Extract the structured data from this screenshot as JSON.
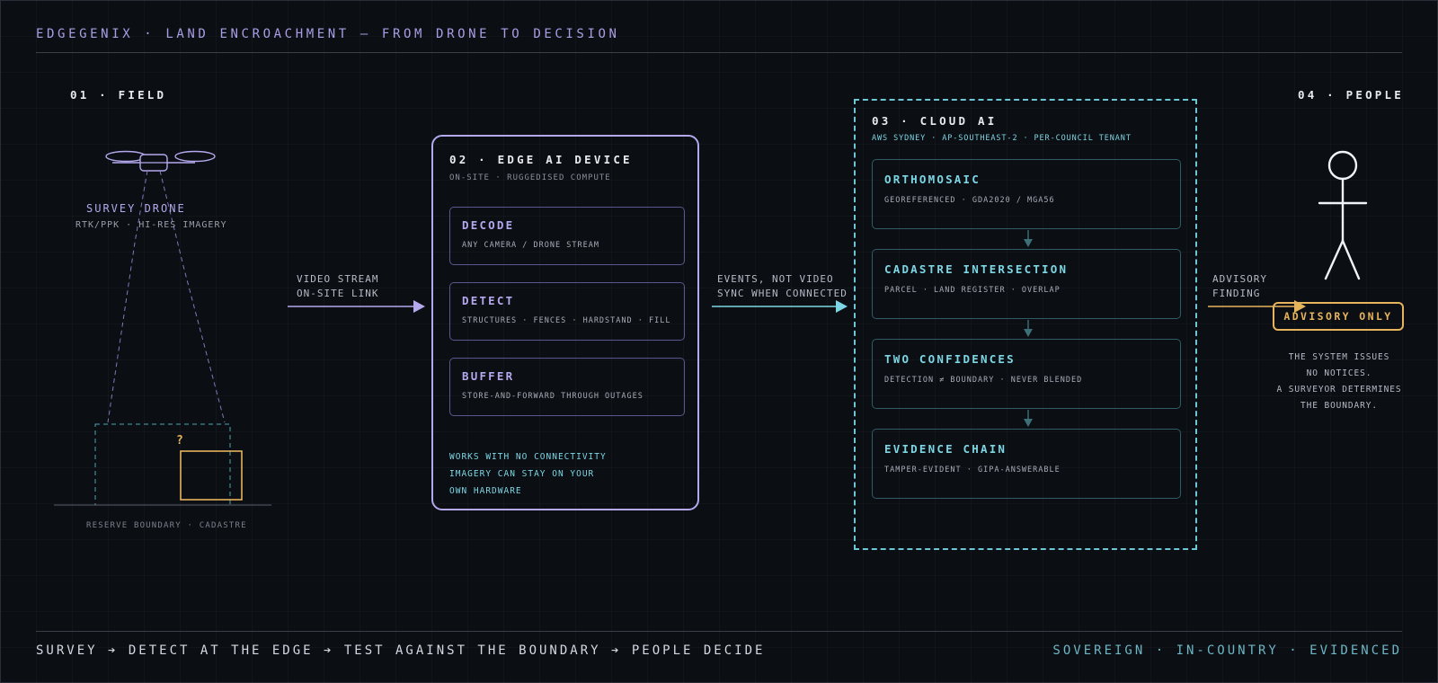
{
  "header": {
    "title": "EDGEGENIX · LAND ENCROACHMENT — FROM DRONE TO DECISION"
  },
  "field": {
    "title": "01 · FIELD",
    "drone_label": "SURVEY DRONE",
    "drone_sub": "RTK/PPK · HI-RES IMAGERY",
    "question_mark": "?",
    "ground_label": "RESERVE BOUNDARY · CADASTRE"
  },
  "link1": {
    "line1": "VIDEO STREAM",
    "line2": "ON-SITE LINK"
  },
  "edge": {
    "title": "02 · EDGE AI DEVICE",
    "subtitle": "ON-SITE · RUGGEDISED COMPUTE",
    "cards": [
      {
        "title": "DECODE",
        "sub": "ANY CAMERA / DRONE STREAM"
      },
      {
        "title": "DETECT",
        "sub": "STRUCTURES · FENCES · HARDSTAND · FILL"
      },
      {
        "title": "BUFFER",
        "sub": "STORE-AND-FORWARD THROUGH OUTAGES"
      }
    ],
    "notes": [
      "WORKS WITH NO CONNECTIVITY",
      "IMAGERY CAN STAY ON YOUR",
      "OWN HARDWARE"
    ]
  },
  "link2": {
    "line1": "EVENTS, NOT VIDEO",
    "line2": "SYNC WHEN CONNECTED"
  },
  "cloud": {
    "title": "03 · CLOUD AI",
    "subtitle": "AWS SYDNEY · AP-SOUTHEAST-2 · PER-COUNCIL TENANT",
    "cards": [
      {
        "title": "ORTHOMOSAIC",
        "sub": "GEOREFERENCED · GDA2020 / MGA56"
      },
      {
        "title": "CADASTRE INTERSECTION",
        "sub": "PARCEL · LAND REGISTER · OVERLAP"
      },
      {
        "title": "TWO CONFIDENCES",
        "sub": "DETECTION ≠ BOUNDARY · NEVER BLENDED"
      },
      {
        "title": "EVIDENCE CHAIN",
        "sub": "TAMPER-EVIDENT · GIPA-ANSWERABLE"
      }
    ]
  },
  "link3": {
    "line1": "ADVISORY",
    "line2": "FINDING"
  },
  "people": {
    "title": "04 · PEOPLE",
    "badge": "ADVISORY ONLY",
    "notes": [
      "THE SYSTEM ISSUES",
      "NO NOTICES.",
      "A SURVEYOR DETERMINES",
      "THE BOUNDARY."
    ]
  },
  "footer": {
    "flow": "SURVEY ➔ DETECT AT THE EDGE ➔ TEST AGAINST THE BOUNDARY ➔ PEOPLE DECIDE",
    "tagline": "SOVEREIGN · IN-COUNTRY · EVIDENCED"
  },
  "colors": {
    "edge_accent": "#b4a8ee",
    "cloud_accent": "#7cd6e4",
    "advisory_accent": "#e6b45c",
    "background": "#0b0e13"
  }
}
